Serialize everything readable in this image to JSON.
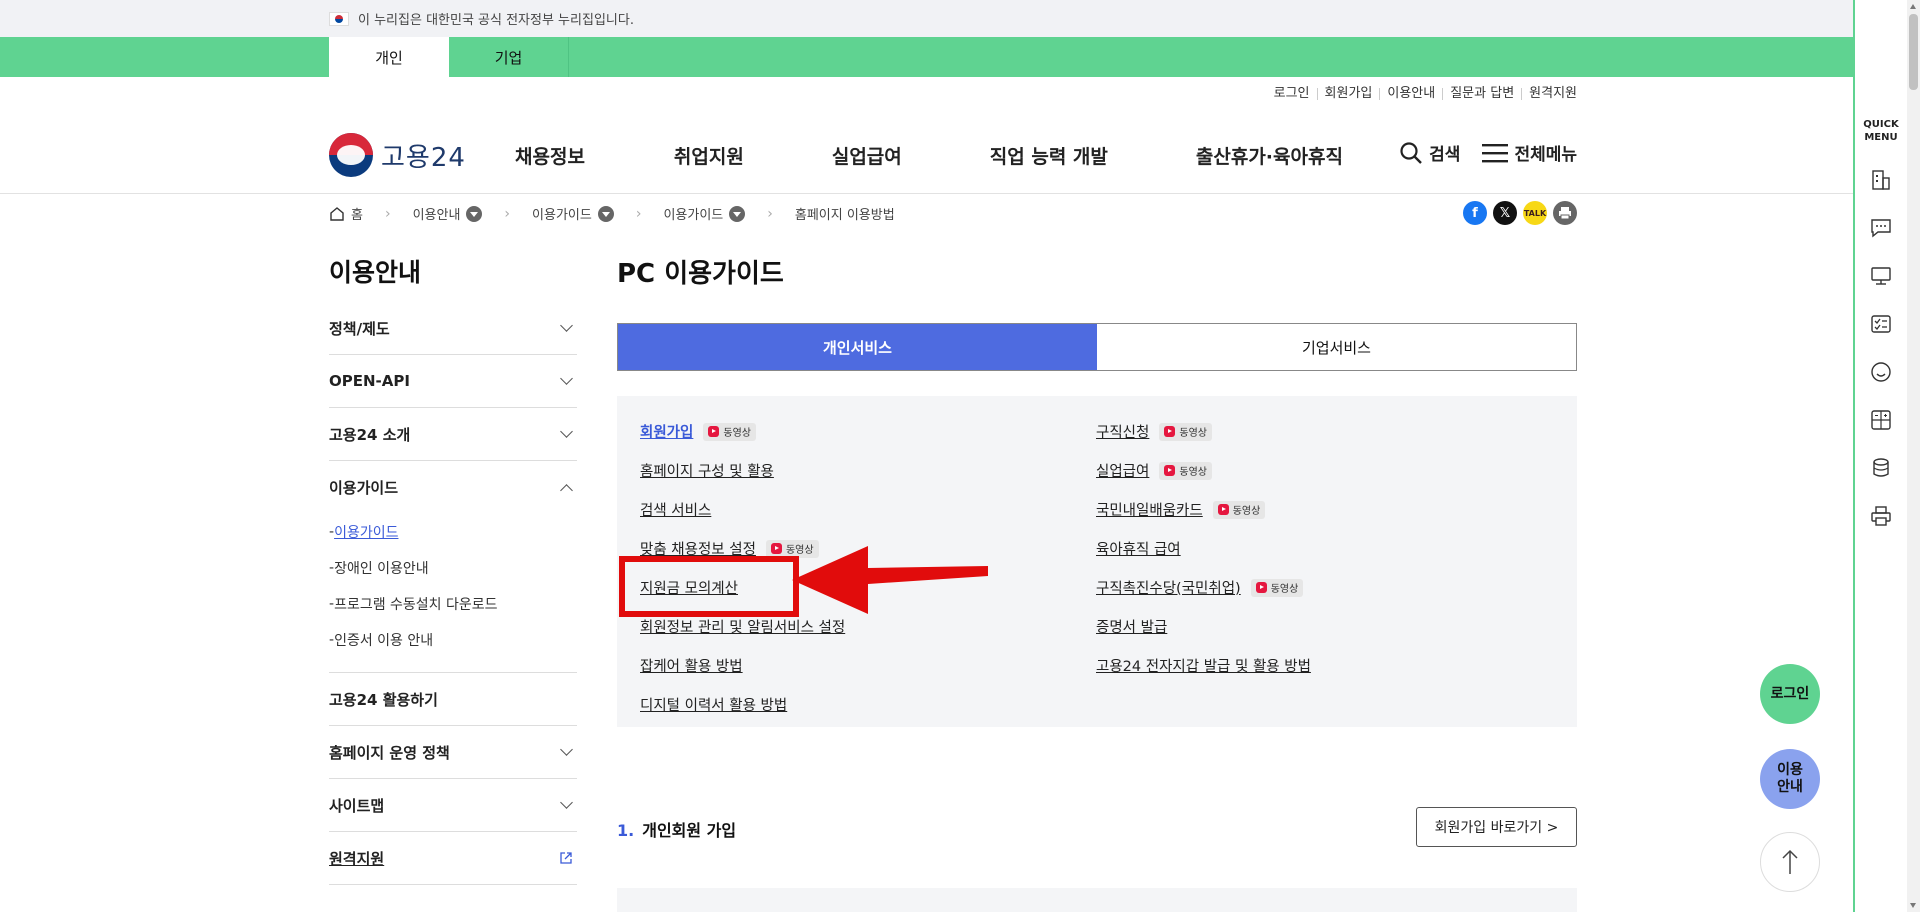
{
  "gov_banner": {
    "text": "이 누리집은 대한민국 공식 전자정부 누리집입니다."
  },
  "top_tabs": [
    "개인",
    "기업"
  ],
  "utility_links": [
    "로그인",
    "회원가입",
    "이용안내",
    "질문과 답변",
    "원격지원"
  ],
  "logo": {
    "text": "고용24"
  },
  "gnb": [
    "채용정보",
    "취업지원",
    "실업급여",
    "직업 능력 개발",
    "출산휴가·육아휴직"
  ],
  "header_actions": {
    "search": "검색",
    "all_menu": "전체메뉴"
  },
  "breadcrumb": [
    "홈",
    "이용안내",
    "이용가이드",
    "이용가이드",
    "홈페이지 이용방법"
  ],
  "share": {
    "colors": {
      "facebook": "#1877f2",
      "x": "#111111",
      "kakao": "#f7d816",
      "print": "#666666"
    }
  },
  "sidebar": {
    "title": "이용안내",
    "items": [
      "정책/제도",
      "OPEN-API",
      "고용24 소개"
    ],
    "group": {
      "label": "이용가이드",
      "subitems": [
        "이용가이드",
        "장애인 이용안내",
        "프로그램 수동설치 다운로드",
        "인증서 이용 안내"
      ]
    },
    "items_after": [
      "고용24 활용하기",
      "홈페이지 운영 정책",
      "사이트맵"
    ],
    "remote": "원격지원"
  },
  "main": {
    "title": "PC 이용가이드",
    "tabs": [
      "개인서비스",
      "기업서비스"
    ],
    "video_badge": "동영상",
    "left_links": [
      {
        "label": "회원가입",
        "video": true
      },
      {
        "label": "홈페이지 구성 및 활용",
        "video": false
      },
      {
        "label": "검색 서비스",
        "video": false
      },
      {
        "label": "맞춤 채용정보 설정",
        "video": true
      },
      {
        "label": "지원금 모의계산",
        "video": false
      },
      {
        "label": "회원정보 관리 및 알림서비스 설정",
        "video": false
      },
      {
        "label": "잡케어 활용 방법",
        "video": false
      },
      {
        "label": "디지털 이력서 활용 방법",
        "video": false
      }
    ],
    "right_links": [
      {
        "label": "구직신청",
        "video": true
      },
      {
        "label": "실업급여",
        "video": true
      },
      {
        "label": "국민내일배움카드",
        "video": true
      },
      {
        "label": "육아휴직 급여",
        "video": false
      },
      {
        "label": "구직촉진수당(국민취업)",
        "video": true
      },
      {
        "label": "증명서 발급",
        "video": false
      },
      {
        "label": "고용24 전자지갑 발급 및 활용 방법",
        "video": false
      }
    ],
    "section": {
      "num": "1.",
      "title": "개인회원 가입",
      "button": "회원가입 바로가기 >"
    }
  },
  "quick_menu": {
    "title": "QUICK MENU"
  },
  "floating": {
    "login": "로그인",
    "guide_line1": "이용",
    "guide_line2": "안내"
  },
  "colors": {
    "green": "#5fd391",
    "blue": "#4e6be0",
    "link_active": "#3a5ad8",
    "annotation": "#e10c0c"
  }
}
